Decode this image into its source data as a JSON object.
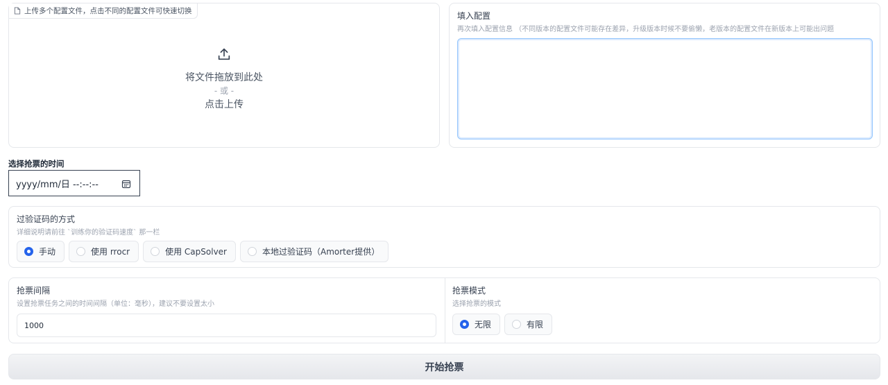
{
  "upload": {
    "label": "上传多个配置文件，点击不同的配置文件可快速切换",
    "drop_text": "将文件拖放到此处",
    "or_text": "- 或 -",
    "click_text": "点击上传"
  },
  "config": {
    "label": "填入配置",
    "info": "再次填入配置信息 （不同版本的配置文件可能存在差异，升级版本时候不要偷懒，老版本的配置文件在新版本上可能出问题",
    "value": ""
  },
  "time": {
    "label": "选择抢票的时间",
    "placeholder": "yyyy/mm/日 --:--:--"
  },
  "captcha": {
    "label": "过验证码的方式",
    "info": "详细说明请前往 `训练你的验证码速度` 那一栏",
    "options": [
      "手动",
      "使用 rrocr",
      "使用 CapSolver",
      "本地过验证码（Amorter提供）"
    ],
    "selected": "手动"
  },
  "interval": {
    "label": "抢票间隔",
    "info": "设置抢票任务之间的时间间隔（单位：毫秒），建议不要设置太小",
    "value": "1000"
  },
  "mode": {
    "label": "抢票模式",
    "info": "选择抢票的模式",
    "options": [
      "无限",
      "有限"
    ],
    "selected": "无限"
  },
  "start_button": {
    "label": "开始抢票"
  },
  "colors": {
    "accent": "#2563eb",
    "border": "#e5e7eb"
  }
}
